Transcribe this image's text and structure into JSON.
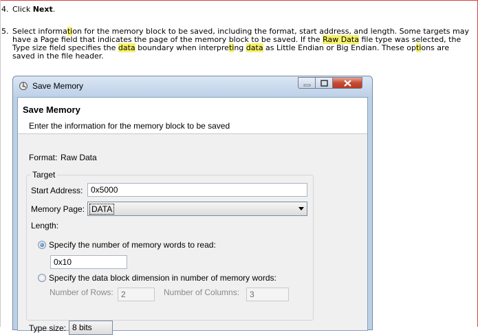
{
  "doc": {
    "step4": {
      "num": "4.",
      "prefix": "Click ",
      "bold": "Next",
      "suffix": "."
    },
    "step5": {
      "num": "5.",
      "text_a": "Select informa",
      "hl_a": "ti",
      "text_b": "on for the memory block to be saved, including the format, start address, and length. Some targets may have a Page field that indicates the page of the memory block to be saved. If the ",
      "hl_b": "Raw Data",
      "text_c": " file type was selected, the Type size field specifies the ",
      "hl_c": "data",
      "text_d": " boundary when interpre",
      "hl_d": "ti",
      "text_e": "ng ",
      "hl_e": "data",
      "text_f": " as Little Endian or Big Endian. These op",
      "hl_f": "ti",
      "text_g": "ons are saved in the file header."
    }
  },
  "dialog": {
    "title": "Save Memory",
    "header_title": "Save Memory",
    "header_desc": "Enter the information for the memory block to be saved",
    "format_label": "Format:",
    "format_value": "Raw Data",
    "target_legend": "Target",
    "start_address_label": "Start Address:",
    "start_address_value": "0x5000",
    "memory_page_label": "Memory Page:",
    "memory_page_value": "DATA",
    "length_label": "Length:",
    "radio_words_label": "Specify the number of memory words to read:",
    "words_value": "0x10",
    "radio_dims_label": "Specify the data block dimension in number of memory words:",
    "rows_label": "Number of Rows:",
    "rows_value": "2",
    "cols_label": "Number of Columns:",
    "cols_value": "3",
    "type_size_label": "Type size:",
    "type_size_value": "8 bits"
  },
  "colors": {
    "highlight": "#f7f26a",
    "close_button": "#c74a33",
    "titlebar": "#bcd0e8"
  }
}
